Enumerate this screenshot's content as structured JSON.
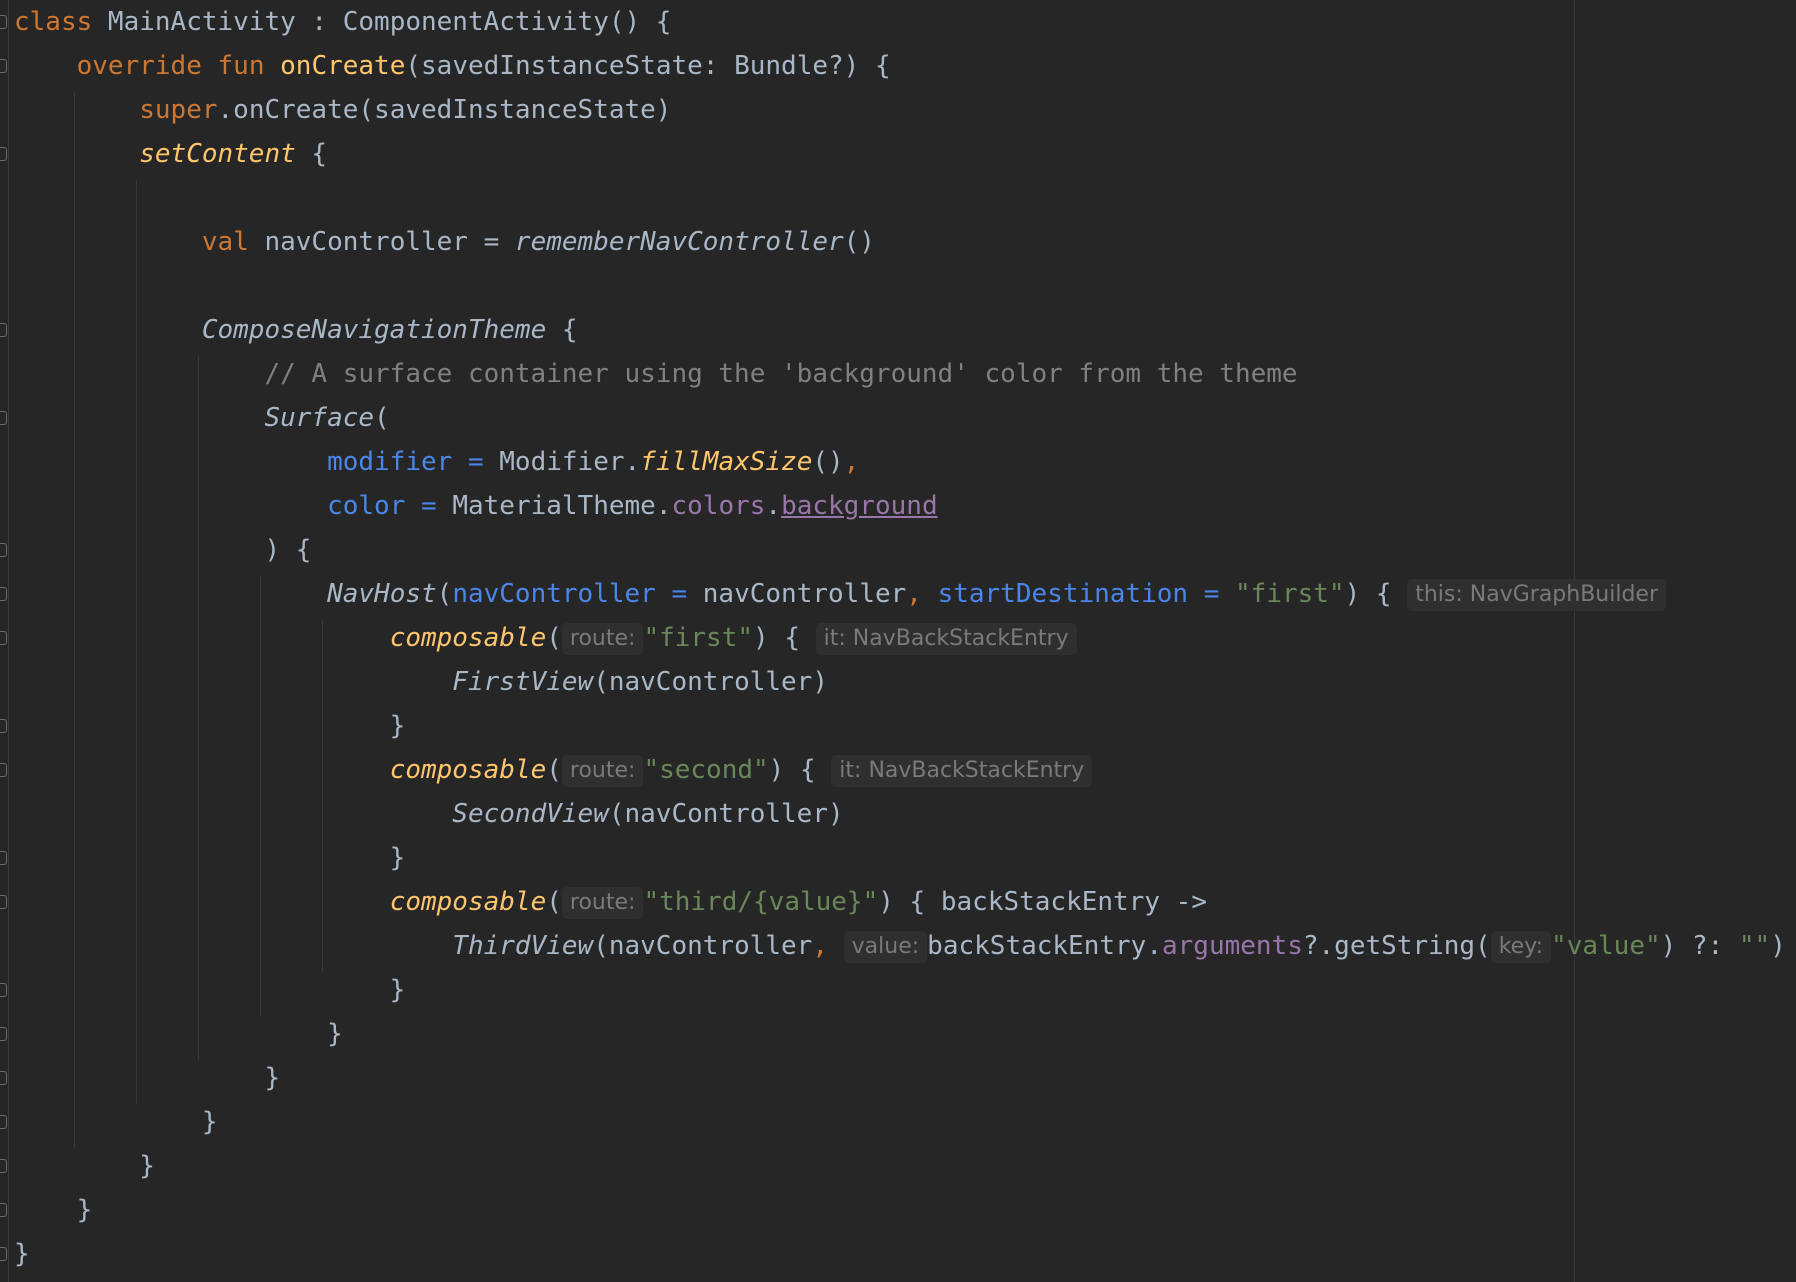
{
  "editor": {
    "lines": [
      {
        "tokens": [
          {
            "t": "class",
            "c": "kw"
          },
          {
            "t": " MainActivity : ComponentActivity() {",
            "c": ""
          }
        ]
      },
      {
        "tokens": [
          {
            "t": "    ",
            "c": ""
          },
          {
            "t": "override",
            "c": "kw"
          },
          {
            "t": " ",
            "c": ""
          },
          {
            "t": "fun",
            "c": "kw"
          },
          {
            "t": " ",
            "c": ""
          },
          {
            "t": "onCreate",
            "c": "fn"
          },
          {
            "t": "(savedInstanceState: Bundle?) {",
            "c": ""
          }
        ]
      },
      {
        "tokens": [
          {
            "t": "        ",
            "c": ""
          },
          {
            "t": "super",
            "c": "kw"
          },
          {
            "t": ".onCreate(savedInstanceState)",
            "c": ""
          }
        ]
      },
      {
        "tokens": [
          {
            "t": "        ",
            "c": ""
          },
          {
            "t": "setContent",
            "c": "fni"
          },
          {
            "t": " {",
            "c": ""
          }
        ]
      },
      {
        "tokens": []
      },
      {
        "tokens": [
          {
            "t": "            ",
            "c": ""
          },
          {
            "t": "val",
            "c": "kw"
          },
          {
            "t": " navController = ",
            "c": ""
          },
          {
            "t": "rememberNavController",
            "c": "ital"
          },
          {
            "t": "()",
            "c": ""
          }
        ]
      },
      {
        "tokens": []
      },
      {
        "tokens": [
          {
            "t": "            ",
            "c": ""
          },
          {
            "t": "ComposeNavigationTheme",
            "c": "ital"
          },
          {
            "t": " {",
            "c": ""
          }
        ]
      },
      {
        "tokens": [
          {
            "t": "                ",
            "c": ""
          },
          {
            "t": "// A surface container using the 'background' color from the theme",
            "c": "cmt"
          }
        ]
      },
      {
        "tokens": [
          {
            "t": "                ",
            "c": ""
          },
          {
            "t": "Surface",
            "c": "ital"
          },
          {
            "t": "(",
            "c": ""
          }
        ]
      },
      {
        "tokens": [
          {
            "t": "                    ",
            "c": ""
          },
          {
            "t": "modifier",
            "c": "prm"
          },
          {
            "t": " = ",
            "c": "prm"
          },
          {
            "t": "Modifier.",
            "c": ""
          },
          {
            "t": "fillMaxSize",
            "c": "fni"
          },
          {
            "t": "()",
            "c": ""
          },
          {
            "t": ",",
            "c": "kw"
          }
        ]
      },
      {
        "tokens": [
          {
            "t": "                    ",
            "c": ""
          },
          {
            "t": "color",
            "c": "prm"
          },
          {
            "t": " = ",
            "c": "prm"
          },
          {
            "t": "MaterialTheme.",
            "c": ""
          },
          {
            "t": "colors",
            "c": "prop"
          },
          {
            "t": ".",
            "c": ""
          },
          {
            "t": "background",
            "c": "propu"
          }
        ]
      },
      {
        "tokens": [
          {
            "t": "                ) {",
            "c": ""
          }
        ]
      },
      {
        "tokens": [
          {
            "t": "                    ",
            "c": ""
          },
          {
            "t": "NavHost",
            "c": "ital"
          },
          {
            "t": "(",
            "c": ""
          },
          {
            "t": "navController",
            "c": "prm"
          },
          {
            "t": " = ",
            "c": "prm"
          },
          {
            "t": "navController",
            "c": ""
          },
          {
            "t": ", ",
            "c": "kw"
          },
          {
            "t": "startDestination",
            "c": "prm"
          },
          {
            "t": " = ",
            "c": "prm"
          },
          {
            "t": "\"first\"",
            "c": "str"
          },
          {
            "t": ") { ",
            "c": ""
          },
          {
            "t": "this: NavGraphBuilder",
            "c": "hint"
          }
        ]
      },
      {
        "tokens": [
          {
            "t": "                        ",
            "c": ""
          },
          {
            "t": "composable",
            "c": "fni"
          },
          {
            "t": "(",
            "c": ""
          },
          {
            "t": "route:",
            "c": "hint"
          },
          {
            "t": "\"first\"",
            "c": "str"
          },
          {
            "t": ") { ",
            "c": ""
          },
          {
            "t": "it: NavBackStackEntry",
            "c": "hint"
          }
        ]
      },
      {
        "tokens": [
          {
            "t": "                            ",
            "c": ""
          },
          {
            "t": "FirstView",
            "c": "ital"
          },
          {
            "t": "(navController)",
            "c": ""
          }
        ]
      },
      {
        "tokens": [
          {
            "t": "                        }",
            "c": ""
          }
        ]
      },
      {
        "tokens": [
          {
            "t": "                        ",
            "c": ""
          },
          {
            "t": "composable",
            "c": "fni"
          },
          {
            "t": "(",
            "c": ""
          },
          {
            "t": "route:",
            "c": "hint"
          },
          {
            "t": "\"second\"",
            "c": "str"
          },
          {
            "t": ") { ",
            "c": ""
          },
          {
            "t": "it: NavBackStackEntry",
            "c": "hint"
          }
        ]
      },
      {
        "tokens": [
          {
            "t": "                            ",
            "c": ""
          },
          {
            "t": "SecondView",
            "c": "ital"
          },
          {
            "t": "(navController)",
            "c": ""
          }
        ]
      },
      {
        "tokens": [
          {
            "t": "                        }",
            "c": ""
          }
        ]
      },
      {
        "tokens": [
          {
            "t": "                        ",
            "c": ""
          },
          {
            "t": "composable",
            "c": "fni"
          },
          {
            "t": "(",
            "c": ""
          },
          {
            "t": "route:",
            "c": "hint"
          },
          {
            "t": "\"third/{value}\"",
            "c": "str"
          },
          {
            "t": ") { backStackEntry ->",
            "c": ""
          }
        ]
      },
      {
        "tokens": [
          {
            "t": "                            ",
            "c": ""
          },
          {
            "t": "ThirdView",
            "c": "ital"
          },
          {
            "t": "(navController",
            "c": ""
          },
          {
            "t": ", ",
            "c": "kw"
          },
          {
            "t": "value:",
            "c": "hint"
          },
          {
            "t": "backStackEntry.",
            "c": ""
          },
          {
            "t": "arguments",
            "c": "prop"
          },
          {
            "t": "?.getString(",
            "c": ""
          },
          {
            "t": "key:",
            "c": "hint"
          },
          {
            "t": "\"value\"",
            "c": "str"
          },
          {
            "t": ") ?: ",
            "c": ""
          },
          {
            "t": "\"\"",
            "c": "str"
          },
          {
            "t": ")",
            "c": ""
          }
        ]
      },
      {
        "tokens": [
          {
            "t": "                        }",
            "c": ""
          }
        ]
      },
      {
        "tokens": [
          {
            "t": "                    }",
            "c": ""
          }
        ]
      },
      {
        "tokens": [
          {
            "t": "                }",
            "c": ""
          }
        ]
      },
      {
        "tokens": [
          {
            "t": "            }",
            "c": ""
          }
        ]
      },
      {
        "tokens": [
          {
            "t": "        }",
            "c": ""
          }
        ]
      },
      {
        "tokens": [
          {
            "t": "    }",
            "c": ""
          }
        ]
      },
      {
        "tokens": [
          {
            "t": "}",
            "c": ""
          }
        ]
      }
    ]
  },
  "colors": {
    "background": "#262626",
    "keyword": "#cc7832",
    "function": "#ffc66d",
    "string": "#6a8759",
    "parameter": "#4a86e8",
    "property": "#9876aa",
    "comment": "#808080",
    "default": "#a9b7c6"
  }
}
